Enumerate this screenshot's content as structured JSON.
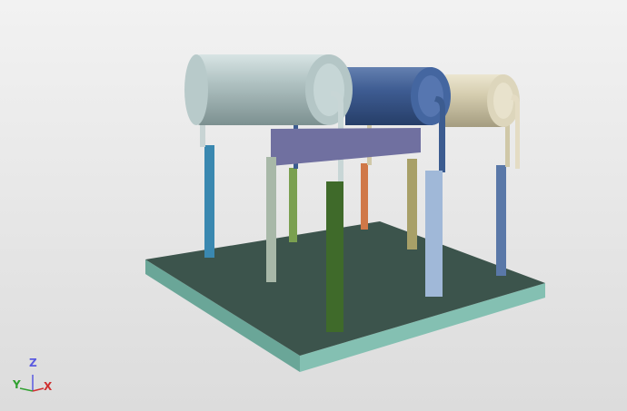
{
  "triad": {
    "x_label": "X",
    "y_label": "Y",
    "z_label": "Z"
  },
  "colors": {
    "board_top": "#3c544c",
    "board_side": "#7ab6a8",
    "cylinder_grey": "#a8bcbc",
    "cylinder_blue": "#3c5c90",
    "cylinder_tan": "#d0c8a8",
    "plate": "#7070a0"
  }
}
